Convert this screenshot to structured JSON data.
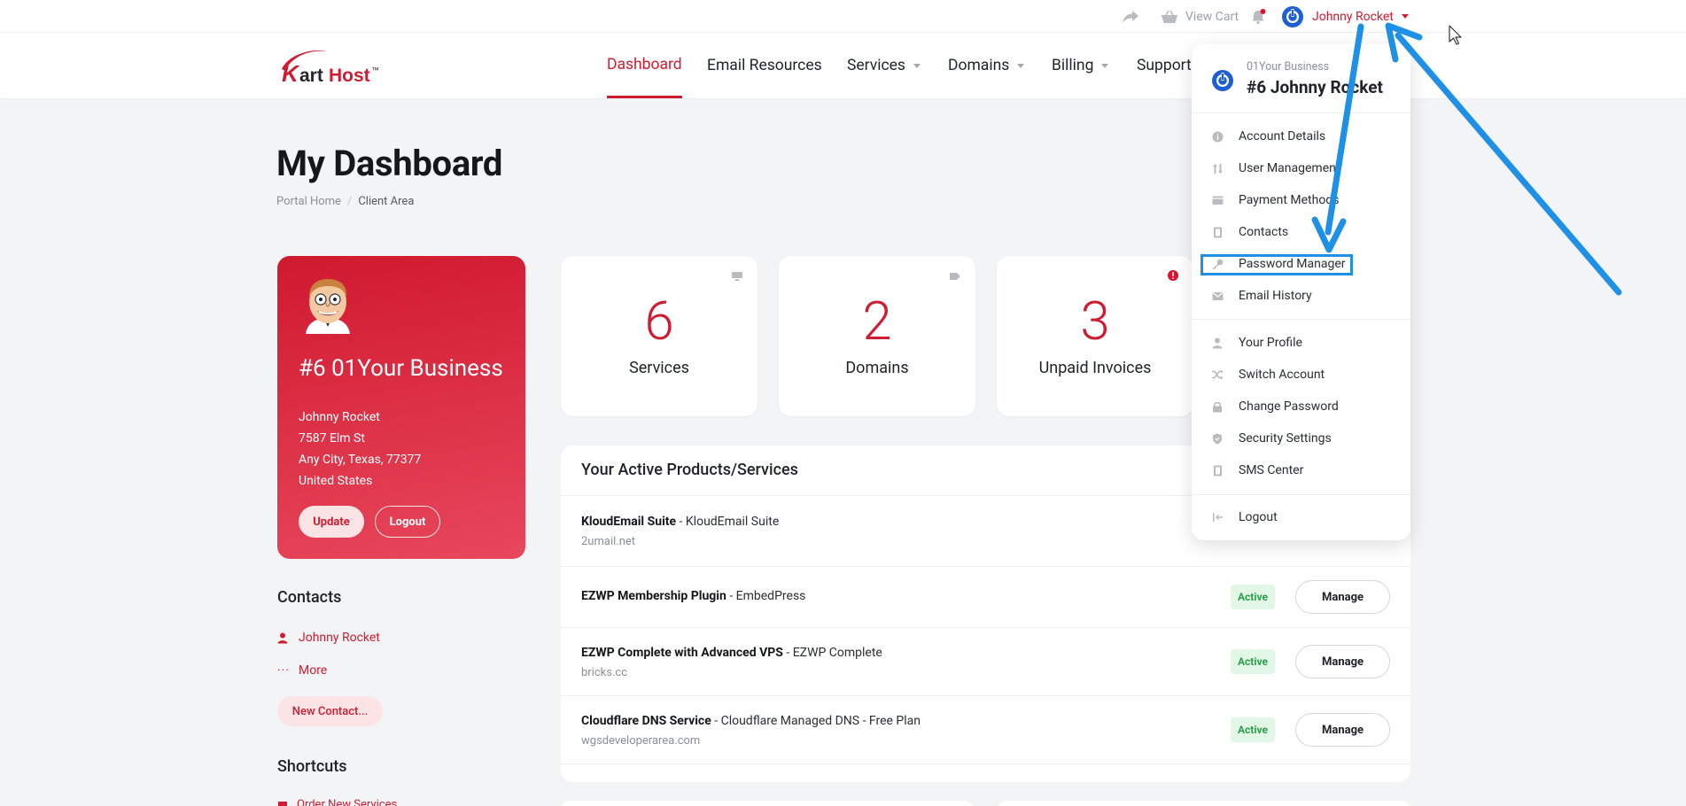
{
  "topbar": {
    "share_icon": "share-icon",
    "cart_icon": "basket-icon",
    "view_cart": "View Cart",
    "user_name": "Johnny Rocket"
  },
  "navbar": {
    "logo_text": "KartHost",
    "logo_tm": "™",
    "items": [
      {
        "label": "Dashboard",
        "active": true
      },
      {
        "label": "Email Resources"
      },
      {
        "label": "Services"
      },
      {
        "label": "Domains"
      },
      {
        "label": "Billing"
      },
      {
        "label": "Support"
      }
    ]
  },
  "page": {
    "title": "My Dashboard",
    "breadcrumb": [
      "Portal Home",
      "Client Area"
    ]
  },
  "profile": {
    "business": "#6 01Your Business",
    "name": "Johnny Rocket",
    "street": "7587 Elm St",
    "city": "Any City, Texas, 77377",
    "country": "United States",
    "update": "Update",
    "logout": "Logout"
  },
  "stats": [
    {
      "value": "6",
      "label": "Services",
      "icon": "monitor-icon"
    },
    {
      "value": "2",
      "label": "Domains",
      "icon": "tag-icon"
    },
    {
      "value": "3",
      "label": "Unpaid Invoices",
      "icon": "alert-icon"
    }
  ],
  "products": {
    "header": "Your Active Products/Services",
    "rows": [
      {
        "name": "KloudEmail Suite",
        "product": " - KloudEmail Suite",
        "domain": "2umail.net",
        "status": "",
        "manage": ""
      },
      {
        "name": "EZWP Membership Plugin",
        "product": " - EmbedPress",
        "domain": "",
        "status": "Active",
        "manage": "Manage"
      },
      {
        "name": "EZWP Complete with Advanced VPS",
        "product": " - EZWP Complete",
        "domain": "bricks.cc",
        "status": "Active",
        "manage": "Manage"
      },
      {
        "name": "Cloudflare DNS Service",
        "product": " - Cloudflare Managed DNS - Free Plan",
        "domain": "wgsdeveloperarea.com",
        "status": "Active",
        "manage": "Manage"
      }
    ]
  },
  "contacts": {
    "title": "Contacts",
    "person": "Johnny Rocket",
    "more": "More",
    "new_contact": "New Contact..."
  },
  "shortcuts": {
    "title": "Shortcuts",
    "first": "Order New Services"
  },
  "menu": {
    "account_label": "01Your Business",
    "account_name": "#6 Johnny Rocket",
    "items": [
      {
        "label": "Account Details",
        "icon": "info-icon"
      },
      {
        "label": "User Management",
        "icon": "arrows-icon"
      },
      {
        "label": "Payment Methods",
        "icon": "wallet-icon"
      },
      {
        "label": "Contacts",
        "icon": "contact-book-icon"
      },
      {
        "label": "Password Manager",
        "icon": "key-icon"
      },
      {
        "label": "Email History",
        "icon": "envelope-icon"
      },
      {
        "label": "Your Profile",
        "icon": "user-icon"
      },
      {
        "label": "Switch Account",
        "icon": "shuffle-icon"
      },
      {
        "label": "Change Password",
        "icon": "lock-icon"
      },
      {
        "label": "Security Settings",
        "icon": "shield-icon"
      },
      {
        "label": "SMS Center",
        "icon": "phone-icon"
      },
      {
        "label": "Logout",
        "icon": "logout-icon"
      }
    ]
  },
  "colors": {
    "brand_red": "#cf1c31",
    "annotation_blue": "#1e90e6",
    "active_green": "#2e9e4f"
  }
}
